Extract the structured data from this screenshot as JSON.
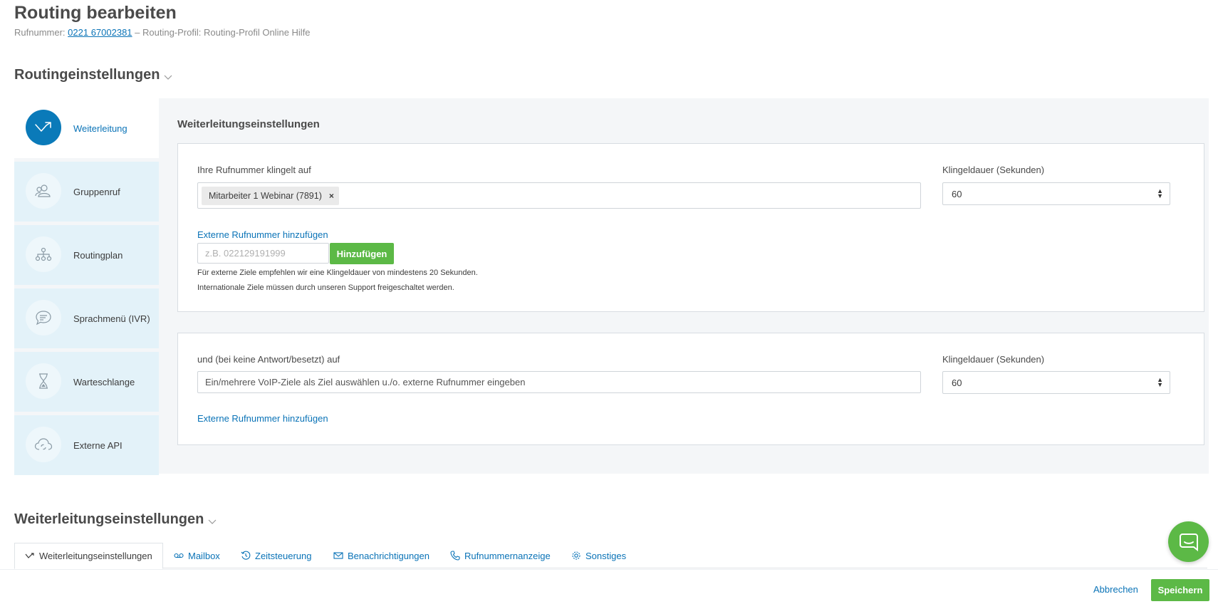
{
  "header": {
    "title": "Routing bearbeiten",
    "number_prefix": "Rufnummer:",
    "number": "0221 67002381",
    "profile_text": "– Routing-Profil: Routing-Profil Online Hilfe"
  },
  "routing_section": {
    "title": "Routingeinstellungen"
  },
  "sidebar": {
    "items": [
      {
        "label": "Weiterleitung",
        "icon": "forward-arrow-icon",
        "active": true
      },
      {
        "label": "Gruppenruf",
        "icon": "group-users-icon",
        "active": false
      },
      {
        "label": "Routingplan",
        "icon": "routing-tree-icon",
        "active": false
      },
      {
        "label": "Sprachmenü (IVR)",
        "icon": "speech-bubble-icon",
        "active": false
      },
      {
        "label": "Warteschlange",
        "icon": "hourglass-icon",
        "active": false
      },
      {
        "label": "Externe API",
        "icon": "cloud-sync-icon",
        "active": false
      }
    ]
  },
  "forwarding": {
    "title": "Weiterleitungseinstellungen",
    "primary": {
      "label": "Ihre Rufnummer klingelt auf",
      "tag": "Mitarbeiter 1 Webinar (7891)",
      "tag_remove": "×",
      "ring_label": "Klingeldauer (Sekunden)",
      "ring_value": "60",
      "external_link": "Externe Rufnummer hinzufügen",
      "external_placeholder": "z.B. 022129191999",
      "add_button": "Hinzufügen",
      "hint1": "Für externe Ziele empfehlen wir eine Klingeldauer von mindestens 20 Sekunden.",
      "hint2": "Internationale Ziele müssen durch unseren Support freigeschaltet werden."
    },
    "fallback": {
      "label": "und (bei keine Antwort/besetzt) auf",
      "placeholder": "Ein/mehrere VoIP-Ziele als Ziel auswählen u./o. externe Rufnummer eingeben",
      "ring_label": "Klingeldauer (Sekunden)",
      "ring_value": "60",
      "external_link": "Externe Rufnummer hinzufügen"
    }
  },
  "settings_section": {
    "title": "Weiterleitungseinstellungen"
  },
  "tabs": [
    {
      "label": "Weiterleitungseinstellungen",
      "icon": "forward-arrow-icon",
      "active": true
    },
    {
      "label": "Mailbox",
      "icon": "voicemail-icon",
      "active": false
    },
    {
      "label": "Zeitsteuerung",
      "icon": "clock-icon",
      "active": false
    },
    {
      "label": "Benachrichtigungen",
      "icon": "envelope-icon",
      "active": false
    },
    {
      "label": "Rufnummernanzeige",
      "icon": "phone-icon",
      "active": false
    },
    {
      "label": "Sonstiges",
      "icon": "gear-icon",
      "active": false
    }
  ],
  "footer": {
    "cancel": "Abbrechen",
    "save": "Speichern"
  },
  "colors": {
    "primary": "#0a7ab9",
    "link": "#0a73b7",
    "success": "#5cb946",
    "sidebar_bg": "#e3f2f9",
    "panel_bg": "#f4f6f8"
  }
}
